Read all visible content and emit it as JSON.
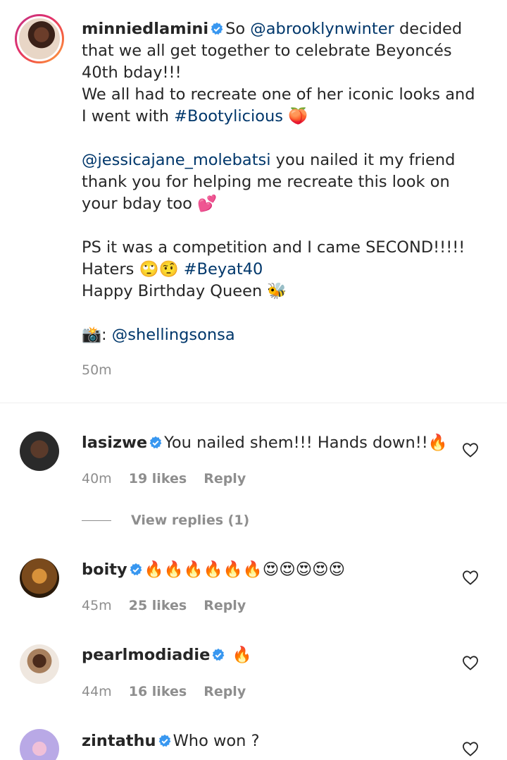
{
  "caption": {
    "username": "minniedlamini",
    "lines": [
      "So @abrooklynwinter decided that we all get together to celebrate Beyoncés 40th bday!!!",
      "We all had to recreate one of her iconic looks and I went with #Bootylicious 🍑",
      "",
      "@jessicajane_molebatsi you nailed it my friend thank you for helping me recreate this look on your bday too 💕",
      "",
      "PS it was a competition and I came SECOND!!!!!",
      "Haters 🙄🤨 #Beyat40",
      "Happy Birthday Queen 🐝",
      "",
      "📸: @shellingsonsa"
    ],
    "mention_1": "@abrooklynwinter",
    "hashtag_1": "#Bootylicious",
    "mention_2": "@jessicajane_molebatsi",
    "hashtag_2": "#Beyat40",
    "mention_3": "@shellingsonsa",
    "time": "50m"
  },
  "comments": [
    {
      "username": "lasizwe",
      "text": "You nailed shem!!! Hands down!!🔥",
      "time": "40m",
      "likes": "19 likes",
      "reply": "Reply",
      "avatar_color": "#3b3b3b"
    },
    {
      "username": "boity",
      "text": "🔥🔥🔥🔥🔥🔥😍😍😍😍😍",
      "time": "45m",
      "likes": "25 likes",
      "reply": "Reply",
      "avatar_color": "#7a4a1c"
    },
    {
      "username": "pearlmodiadie",
      "text": "🔥",
      "time": "44m",
      "likes": "16 likes",
      "reply": "Reply",
      "avatar_color": "#c7a88f"
    },
    {
      "username": "zintathu",
      "text": "Who won ?",
      "avatar_color": "#b9a9e6"
    }
  ],
  "view_replies": "View replies (1)",
  "colors": {
    "link": "#00376b",
    "verified": "#3897f0",
    "muted": "#8e8e8e"
  }
}
